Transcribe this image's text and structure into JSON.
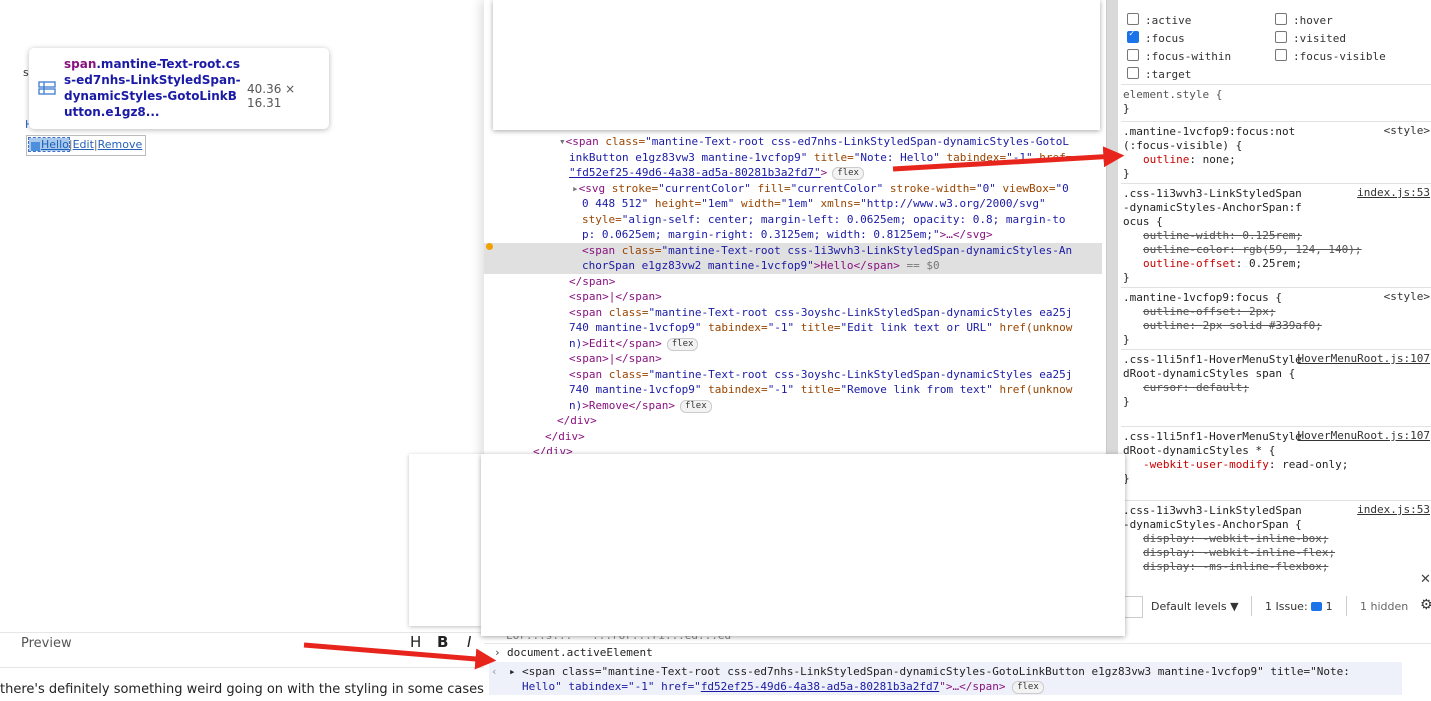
{
  "left": {
    "tooltip": {
      "tag": "span",
      "classes": ".mantine-Text-root.css-ed7nhs-LinkStyledSpan-dynamicStyles-GotoLinkButton.e1gz8...",
      "size": "40.36 × 16.31"
    },
    "hover_menu": {
      "link": "Hello",
      "separator": "|",
      "edit": "Edit",
      "remove": "Remove"
    },
    "preview_label": "Preview",
    "toolbar": {
      "heading": "H",
      "bold": "B",
      "italic": "I"
    },
    "bottom_text": "there's definitely something weird going on with the styling in some cases, alwa"
  },
  "elements": {
    "lines": [
      {
        "indent": 75,
        "parts": [
          "▾",
          "<span ",
          "class=",
          "\"mantine-Text-root css-ed7nhs-LinkStyledSpan-dynamicStyles-GotoL"
        ]
      },
      {
        "indent": 85,
        "parts": [
          "inkButton e1gz83vw3 mantine-1vcfop9\"",
          " title=",
          "\"Note: Hello\"",
          " tabindex=",
          "\"-1\"",
          " href="
        ]
      },
      {
        "indent": 85,
        "parts": [
          "\"fd52ef25-49d6-4a38-ad5a-80281b3a2fd7\"",
          ">"
        ]
      },
      {
        "indent": 88,
        "parts": [
          "▸",
          "<svg ",
          "stroke=",
          "\"currentColor\"",
          " fill=",
          "\"currentColor\"",
          " stroke-width=",
          "\"0\"",
          " viewBox=",
          "\"0"
        ]
      },
      {
        "indent": 98,
        "parts": [
          "0 448 512\"",
          " height=",
          "\"1em\"",
          " width=",
          "\"1em\"",
          " xmlns=",
          "\"http://www.w3.org/2000/svg\""
        ]
      },
      {
        "indent": 98,
        "parts": [
          "style=",
          "\"align-self: center; margin-left: 0.0625em; opacity: 0.8; margin-to"
        ]
      },
      {
        "indent": 98,
        "parts": [
          "p: 0.0625em; margin-right: 0.3125em; width: 0.8125em;\"",
          ">…</svg>"
        ]
      },
      {
        "indent": 98,
        "parts": [
          "<span ",
          "class=",
          "\"mantine-Text-root css-1i3wvh3-LinkStyledSpan-dynamicStyles-An"
        ]
      },
      {
        "indent": 98,
        "parts": [
          "chorSpan e1gz83vw2 mantine-1vcfop9\"",
          ">Hello</span>",
          " == $0"
        ]
      },
      {
        "indent": 85,
        "parts": [
          "</span>"
        ]
      },
      {
        "indent": 85,
        "parts": [
          "<span>",
          "|",
          "</span>"
        ]
      },
      {
        "indent": 85,
        "parts": [
          "<span ",
          "class=",
          "\"mantine-Text-root css-3oyshc-LinkStyledSpan-dynamicStyles ea25j"
        ]
      },
      {
        "indent": 85,
        "parts": [
          "740 mantine-1vcfop9\"",
          " tabindex=",
          "\"-1\"",
          " title=",
          "\"Edit link text or URL\"",
          " href(unknow"
        ]
      },
      {
        "indent": 85,
        "parts": [
          "n)",
          ">Edit</span>"
        ]
      },
      {
        "indent": 85,
        "parts": [
          "<span>",
          "|",
          "</span>"
        ]
      },
      {
        "indent": 85,
        "parts": [
          "<span ",
          "class=",
          "\"mantine-Text-root css-3oyshc-LinkStyledSpan-dynamicStyles ea25j"
        ]
      },
      {
        "indent": 85,
        "parts": [
          "740 mantine-1vcfop9\"",
          " tabindex=",
          "\"-1\"",
          " title=",
          "\"Remove link from text\"",
          " href(unknow"
        ]
      },
      {
        "indent": 85,
        "parts": [
          "n)",
          ">Remove</span>"
        ]
      },
      {
        "indent": 73,
        "parts": [
          "</div>"
        ]
      },
      {
        "indent": 61,
        "parts": [
          "</div>"
        ]
      },
      {
        "indent": 49,
        "parts": [
          "</div>"
        ]
      }
    ],
    "flex_badge": "flex"
  },
  "styles": {
    "pseudo": [
      ":active",
      ":hover",
      ":focus",
      ":visited",
      ":focus-within",
      ":focus-visible",
      ":target"
    ],
    "element_style": "element.style {",
    "close_brace": "}",
    "rules": [
      {
        "selector": ".mantine-1vcfop9:focus:not(:focus-visible) {",
        "source": "<style>",
        "props": [
          {
            "name": "outline",
            "value": "none;",
            "strike": false
          }
        ]
      },
      {
        "selector": ".css-1i3wvh3-LinkStyledSpan-dynamicStyles-AnchorSpan:focus {",
        "source": "index.js:53",
        "props": [
          {
            "name": "outline-width",
            "value": "0.125rem;",
            "strike": true
          },
          {
            "name": "outline-color",
            "value": "rgb(59, 124, 140);",
            "strike": true
          },
          {
            "name": "outline-offset",
            "value": "0.25rem;",
            "strike": false
          }
        ]
      },
      {
        "selector": ".mantine-1vcfop9:focus {",
        "source": "<style>",
        "props": [
          {
            "name": "outline-offset",
            "value": "2px;",
            "strike": true
          },
          {
            "name": "outline",
            "value": "2px solid #339af0;",
            "strike": true
          }
        ]
      },
      {
        "selector": ".css-1li5nf1-HoverMenuStyledRoot-dynamicStyles span {",
        "source": "HoverMenuRoot.js:107",
        "props": [
          {
            "name": "cursor",
            "value": "default;",
            "strike": true
          }
        ]
      },
      {
        "selector": ".css-1li5nf1-HoverMenuStyledRoot-dynamicStyles * {",
        "source": "HoverMenuRoot.js:107",
        "props": [
          {
            "name": "-webkit-user-modify",
            "value": "read-only;",
            "strike": false
          }
        ]
      },
      {
        "selector": ".css-1i3wvh3-LinkStyledSpan-dynamicStyles-AnchorSpan {",
        "source": "index.js:53",
        "props": [
          {
            "name": "display",
            "value": "-webkit-inline-box;",
            "strike": true
          },
          {
            "name": "display",
            "value": "-webkit-inline-flex;",
            "strike": true
          },
          {
            "name": "display",
            "value": "-ms-inline-flexbox;",
            "strike": true
          }
        ]
      }
    ]
  },
  "console_toolbar": {
    "levels": "Default levels ▼",
    "issues": "1 Issue:",
    "issues_count": "1",
    "hidden": "1 hidden"
  },
  "console": {
    "partial_line": "Lor...s...   ...ror...ri...ed...ed",
    "input": "document.activeElement",
    "result_line1": "<span class=\"mantine-Text-root css-ed7nhs-LinkStyledSpan-dynamicStyles-GotoLinkButton e1gz83vw3 mantine-1vcfop9\" title=\"Note:",
    "result_line2_a": "Hello\" tabindex=\"-1\" href=\"",
    "result_href": "fd52ef25-49d6-4a38-ad5a-80281b3a2fd7",
    "result_line2_b": "\">…</span>"
  },
  "colors": {
    "arrow": "#e8251d",
    "tag": "#881280",
    "attr_name": "#994500",
    "attr_value": "#1a1aa6"
  }
}
